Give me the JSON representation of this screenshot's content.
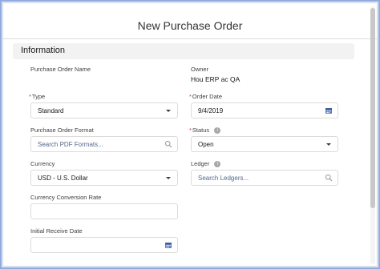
{
  "modal": {
    "title": "New Purchase Order"
  },
  "section": {
    "title": "Information"
  },
  "fields": {
    "purchase_order_name": {
      "label": "Purchase Order Name"
    },
    "owner": {
      "label": "Owner",
      "value": "Hou ERP ac QA"
    },
    "type": {
      "label": "Type",
      "required_mark": "*",
      "value": "Standard",
      "icon": "chevron-down-icon"
    },
    "order_date": {
      "label": "Order Date",
      "required_mark": "*",
      "value": "9/4/2019",
      "icon": "calendar-icon"
    },
    "purchase_order_format": {
      "label": "Purchase Order Format",
      "placeholder": "Search PDF Formats...",
      "icon": "search-icon"
    },
    "status": {
      "label": "Status",
      "required_mark": "*",
      "value": "Open",
      "icon": "chevron-down-icon",
      "info_icon": "info-icon"
    },
    "currency": {
      "label": "Currency",
      "value": "USD - U.S. Dollar",
      "icon": "chevron-down-icon"
    },
    "ledger": {
      "label": "Ledger",
      "placeholder": "Search Ledgers...",
      "icon": "search-icon",
      "info_icon": "info-icon"
    },
    "currency_conversion_rate": {
      "label": "Currency Conversion Rate",
      "value": ""
    },
    "initial_receive_date": {
      "label": "Initial Receive Date",
      "value": "",
      "icon": "calendar-icon"
    }
  },
  "colors": {
    "required": "#c23934",
    "icon": "#706e6b",
    "calendar": "#5a7ab8",
    "section_bg": "#f3f2f2",
    "border": "#dddbda"
  }
}
